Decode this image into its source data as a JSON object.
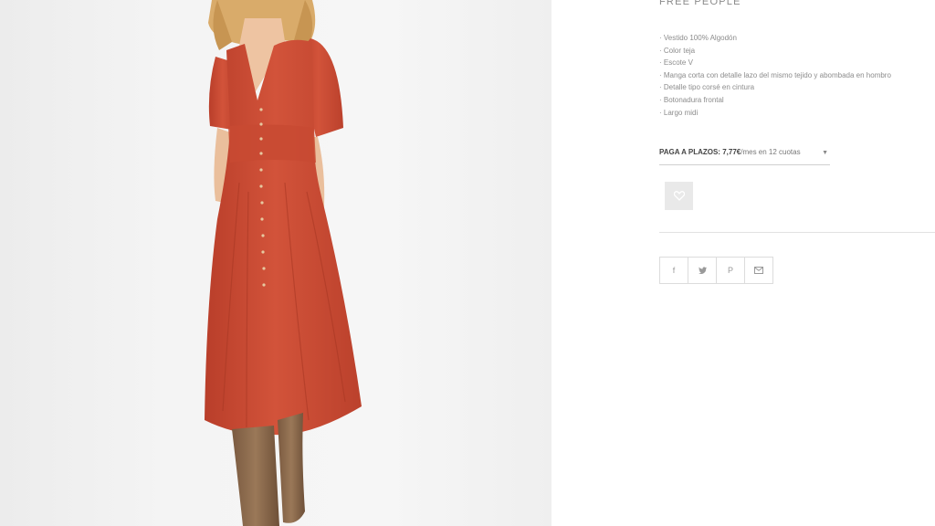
{
  "product": {
    "brand": "FREE PEOPLE",
    "features": [
      "· Vestido 100% Algodón",
      "· Color teja",
      "· Escote V",
      "· Manga corta con detalle lazo del mismo tejido y abombada en hombro",
      "· Detalle tipo corsé en cintura",
      "· Botonadura frontal",
      "· Largo midi"
    ],
    "colors": {
      "dress": "#cc4a32",
      "boots": "#8a6a4e",
      "hair": "#d8a867"
    }
  },
  "installments": {
    "label": "PAGA A PLAZOS:",
    "amount": "7,77€",
    "detail": "/mes en 12 cuotas"
  },
  "icons": {
    "caret": "▼",
    "wishlist": "heart-icon",
    "facebook": "f",
    "twitter": "twitter-icon",
    "pinterest": "P",
    "email": "envelope-icon"
  }
}
